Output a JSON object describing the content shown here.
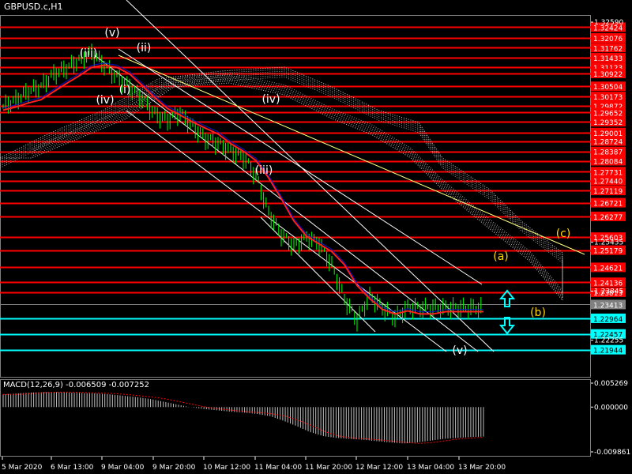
{
  "chart_title": "GBPUSD.c,H1",
  "colors": {
    "background": "#000000",
    "level_red": "#ff0000",
    "level_cyan": "#00ffff",
    "price_bull": "#00ff00",
    "ma_red": "#ff2020",
    "ma_blue": "#1010d0",
    "channel_white": "#ffffff",
    "trend_yellow": "#ffff80",
    "wave_label_white": "#ffffff",
    "wave_label_yellow": "#ffd700",
    "arrow_cyan": "#00ffff"
  },
  "chart_data": [
    {
      "type": "line",
      "title": "GBPUSD.c,H1",
      "price_axis": {
        "ylim": [
          1.2155,
          1.3259
        ],
        "tick_labels": [
          "1.32590",
          "1.25435",
          "1.23845",
          "1.22255"
        ]
      },
      "red_levels": [
        "1.32424",
        "1.32076",
        "1.31762",
        "1.31433",
        "1.31123",
        "1.30922",
        "1.30504",
        "1.30173",
        "1.29872",
        "1.29652",
        "1.29352",
        "1.29001",
        "1.28724",
        "1.28387",
        "1.28084",
        "1.27731",
        "1.27440",
        "1.27119",
        "1.26721",
        "1.26277",
        "1.25603",
        "1.25179",
        "1.24621",
        "1.24136",
        "1.23813"
      ],
      "cyan_levels": [
        "1.22964",
        "1.22457",
        "1.21944"
      ],
      "current_price": "1.23413",
      "time_axis": [
        "5 Mar 2020",
        "6 Mar 13:00",
        "9 Mar 04:00",
        "9 Mar 20:00",
        "10 Mar 12:00",
        "11 Mar 04:00",
        "11 Mar 20:00",
        "12 Mar 12:00",
        "13 Mar 04:00",
        "13 Mar 20:00"
      ],
      "series": [
        {
          "name": "",
          "x": [
            0,
            5,
            10,
            15,
            20,
            25,
            30,
            35,
            40,
            45,
            50,
            55,
            60,
            65,
            70,
            75,
            80,
            85,
            90,
            95,
            100,
            105,
            110,
            115,
            120,
            125,
            130,
            135,
            140,
            145,
            150,
            155,
            160,
            165,
            170,
            175,
            180,
            185,
            190
          ],
          "values": [
            1.2985,
            1.3005,
            1.3035,
            1.305,
            1.309,
            1.311,
            1.3135,
            1.316,
            1.312,
            1.308,
            1.305,
            1.301,
            1.296,
            1.294,
            1.2965,
            1.292,
            1.288,
            1.2865,
            1.284,
            1.282,
            1.276,
            1.264,
            1.257,
            1.253,
            1.256,
            1.254,
            1.247,
            1.236,
            1.229,
            1.237,
            1.233,
            1.23,
            1.233,
            1.233,
            1.233,
            1.233,
            1.233,
            1.233,
            1.233
          ]
        }
      ],
      "wave_labels": [
        "(v)",
        "(iii)",
        "(ii)",
        "(iv)",
        "(i)",
        "(iv)",
        "(iii)",
        "(v)",
        "(a)",
        "(b)",
        "(c)"
      ]
    },
    {
      "type": "bar",
      "title": "MACD(12,26,9) -0.006509 -0.007252",
      "ylim": [
        -0.009861,
        0.005269
      ],
      "tick_labels": [
        "0.005269",
        "0.000000",
        "-0.009861"
      ],
      "values": [
        0.0028,
        0.003,
        0.0032,
        0.0033,
        0.0033,
        0.0032,
        0.0031,
        0.003,
        0.0028,
        0.0025,
        0.0022,
        0.0018,
        0.0012,
        0.0006,
        0.0,
        -0.0004,
        -0.0007,
        -0.001,
        -0.0012,
        -0.0015,
        -0.002,
        -0.003,
        -0.0042,
        -0.0055,
        -0.0064,
        -0.0068,
        -0.007,
        -0.0072,
        -0.0075,
        -0.0078,
        -0.008,
        -0.0078,
        -0.0074,
        -0.007,
        -0.0068,
        -0.0066,
        -0.0065
      ]
    }
  ]
}
